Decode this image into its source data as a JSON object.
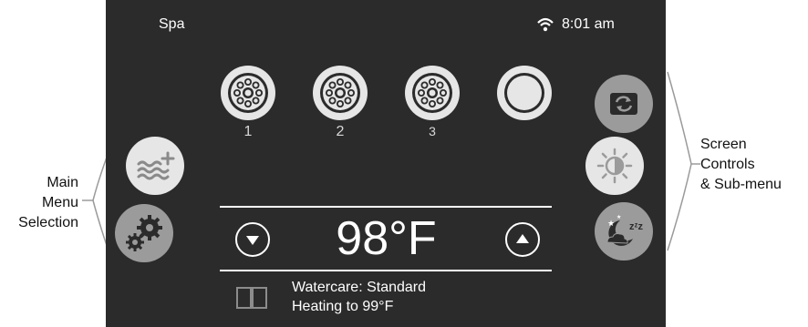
{
  "status_bar": {
    "app_name": "Spa",
    "time": "8:01 am"
  },
  "jets": [
    {
      "label": "1",
      "icon": "jet-icon"
    },
    {
      "label": "2",
      "icon": "jet-icon"
    },
    {
      "label": "3",
      "icon": "jet-icon"
    },
    {
      "label": "",
      "icon": "light-ring-icon"
    }
  ],
  "temperature": {
    "value": "98°F"
  },
  "watercare": {
    "mode_text": "Watercare: Standard",
    "heating_text": "Heating to 99°F"
  },
  "annotations": {
    "left_line1": "Main",
    "left_line2": "Menu",
    "left_line3": "Selection",
    "right_line1": "Screen",
    "right_line2": "Controls",
    "right_line3": "& Sub-menu"
  },
  "colors": {
    "screen_bg": "#2b2b2b",
    "button_gray": "#9b9b9b",
    "button_light": "#e6e6e6"
  }
}
